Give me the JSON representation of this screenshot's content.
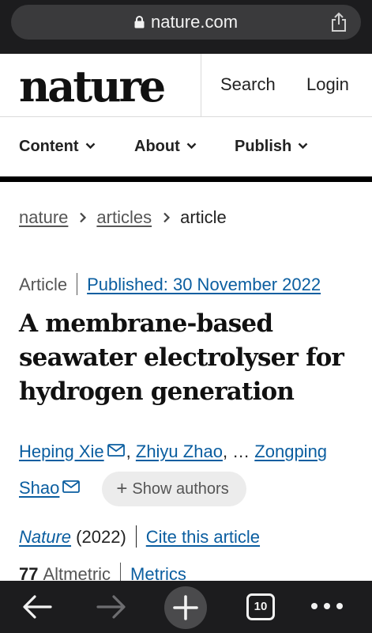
{
  "browser": {
    "url": "nature.com",
    "tab_count": "10"
  },
  "header": {
    "logo": "nature",
    "search": "Search",
    "login": "Login"
  },
  "nav": {
    "items": [
      {
        "label": "Content"
      },
      {
        "label": "About"
      },
      {
        "label": "Publish"
      }
    ]
  },
  "breadcrumb": {
    "items": [
      "nature",
      "articles",
      "article"
    ]
  },
  "article": {
    "type": "Article",
    "published": "Published: 30 November 2022",
    "title": "A membrane-based seawater electrolyser for hydrogen generation",
    "authors": {
      "first": "Heping Xie",
      "second": "Zhiyu Zhao",
      "ellipsis": "…",
      "last_part1": "Zongping",
      "last_part2": "Shao",
      "show_authors": "Show authors"
    },
    "journal": "Nature",
    "year": "(2022)",
    "cite": "Cite this article",
    "altmetric_score": "77",
    "altmetric_label": "Altmetric",
    "metrics": "Metrics"
  },
  "colors": {
    "link": "#0b5ea0",
    "toolbar_bg": "#1c1c1e"
  }
}
